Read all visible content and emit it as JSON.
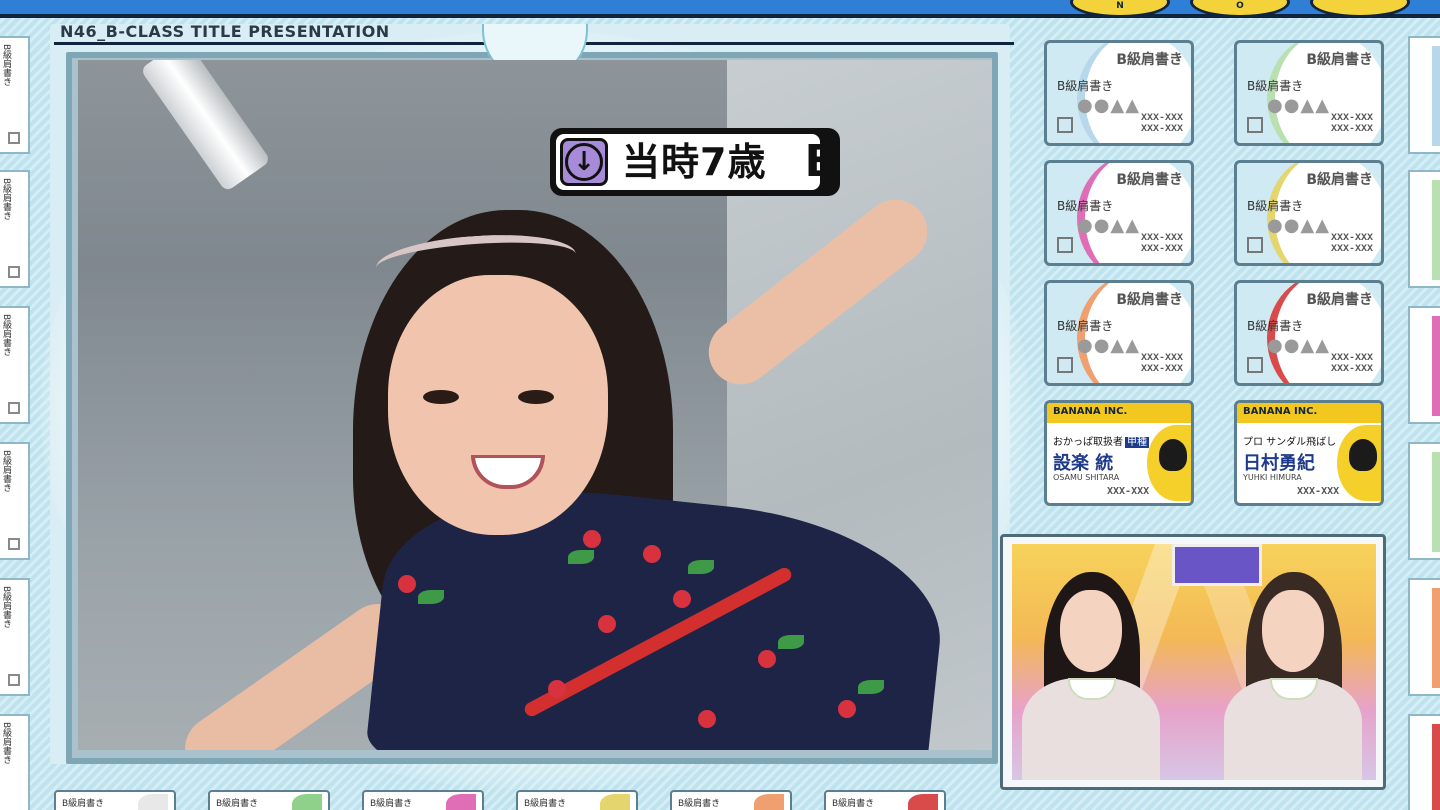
{
  "header": {
    "program_title": "N46_B-CLASS TITLE PRESENTATION",
    "logo_letters": [
      "N",
      "O",
      ""
    ]
  },
  "caption": {
    "arrow": "↓",
    "text": "当時7歳",
    "end_mark": "B"
  },
  "cards": {
    "rows": [
      [
        {
          "label": "B級肩書き",
          "shapes": "●●▲▲",
          "mark": "B級肩書き",
          "code": "XXX-XXX\nXXX-XXX",
          "accent": "#b6d8ea"
        },
        {
          "label": "B級肩書き",
          "shapes": "●●▲▲",
          "mark": "B級肩書き",
          "code": "XXX-XXX\nXXX-XXX",
          "accent": "#b9e0b0"
        }
      ],
      [
        {
          "label": "B級肩書き",
          "shapes": "●●▲▲",
          "mark": "B級肩書き",
          "code": "XXX-XXX\nXXX-XXX",
          "accent": "#e06eb7"
        },
        {
          "label": "B級肩書き",
          "shapes": "●●▲▲",
          "mark": "B級肩書き",
          "code": "XXX-XXX\nXXX-XXX",
          "accent": "#e4d56e"
        }
      ],
      [
        {
          "label": "B級肩書き",
          "shapes": "●●▲▲",
          "mark": "B級肩書き",
          "code": "XXX-XXX\nXXX-XXX",
          "accent": "#f0a070"
        },
        {
          "label": "B級肩書き",
          "shapes": "●●▲▲",
          "mark": "B級肩書き",
          "code": "XXX-XXX\nXXX-XXX",
          "accent": "#d94a4a"
        }
      ]
    ],
    "business": [
      {
        "company": "BANANA INC.",
        "role": "おかっぱ取扱者",
        "role_tag": "甲種",
        "name": "設楽 統",
        "romaji": "OSAMU SHITARA",
        "code": "XXX-XXX"
      },
      {
        "company": "BANANA INC.",
        "role": "プロ サンダル飛ばし",
        "role_tag": "",
        "name": "日村勇紀",
        "romaji": "YUHKI HIMURA",
        "code": "XXX-XXX"
      }
    ]
  },
  "side_label": "B級肩書き",
  "bottom_strip": {
    "labels": [
      "B級肩書き",
      "B級肩書き",
      "B級肩書き",
      "B級肩書き",
      "B級肩書き",
      "B級肩書き"
    ],
    "accents": [
      "#e8e8e8",
      "#8fd08a",
      "#e06eb7",
      "#e4d56e",
      "#f0a070",
      "#d94a4a"
    ]
  },
  "colors": {
    "top_bar": "#2f7fd6",
    "frame_bg": "#bfe3ee",
    "caption_arrow_box": "#a88bd8"
  }
}
